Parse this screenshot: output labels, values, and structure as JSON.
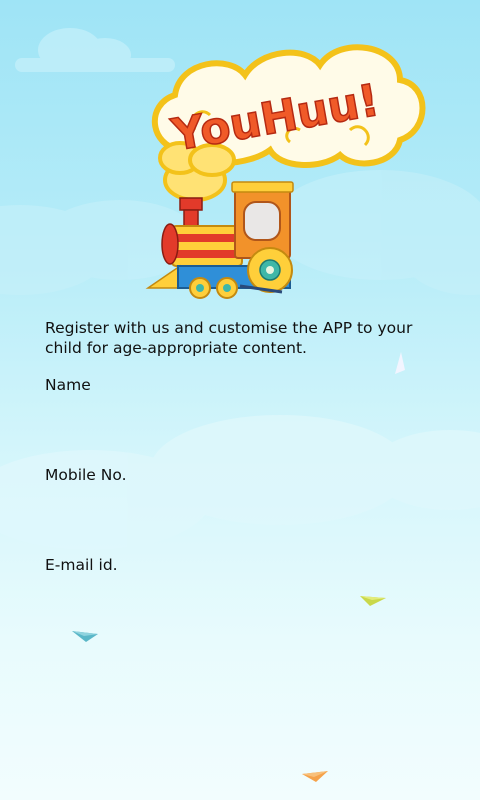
{
  "app": {
    "logo_text": "YouHuu!"
  },
  "register": {
    "intro": "Register with us and customise the APP to your child for age-appropriate content."
  },
  "form": {
    "name_label": "Name",
    "name_value": "",
    "mobile_label": "Mobile No.",
    "mobile_value": "",
    "email_label": "E-mail id.",
    "email_value": ""
  },
  "decor": {
    "plane_colors": [
      "#f2f5ff",
      "#c9d84a",
      "#5ab7c8",
      "#f5a24a"
    ]
  }
}
